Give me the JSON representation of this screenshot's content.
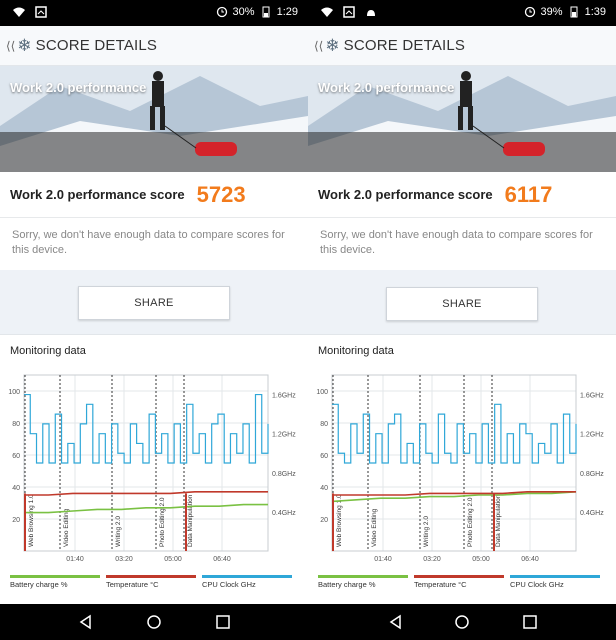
{
  "panels": [
    {
      "status": {
        "battery": "30%",
        "time": "1:29"
      },
      "app_title": "SCORE DETAILS",
      "hero_label": "Work 2.0 performance",
      "score_label": "Work 2.0 performance score",
      "score_value": "5723",
      "sorry_text": "Sorry, we don't have enough data to compare scores for this device.",
      "share_label": "SHARE",
      "monitoring_title": "Monitoring data",
      "chart_data": {
        "type": "line",
        "title": "Monitoring data",
        "y_left_ticks": [
          "100",
          "80",
          "60",
          "40",
          "20"
        ],
        "y_right_ticks": [
          "1.6GHz",
          "1.2GHz",
          "0.8GHz",
          "0.4GHz"
        ],
        "x_ticks": [
          "01:40",
          "03:20",
          "05:00",
          "06:40"
        ],
        "markers": [
          "Web Browsing 1.0",
          "Video Editing",
          "Writing 2.0",
          "Photo Editing 2.0",
          "Data Manipulation"
        ],
        "legend": [
          {
            "name": "Battery charge %",
            "color": "#7ac143"
          },
          {
            "name": "Temperature °C",
            "color": "#c0392b"
          },
          {
            "name": "CPU Clock GHz",
            "color": "#2fa7d8"
          }
        ],
        "series": [
          {
            "name": "Battery charge %",
            "values": [
              24,
              24,
              25,
              26,
              26,
              27,
              27,
              28,
              28,
              29,
              29
            ]
          },
          {
            "name": "Temperature °C",
            "values": [
              35,
              35,
              36,
              36,
              36,
              36,
              36,
              37,
              37,
              37,
              37
            ]
          },
          {
            "name": "CPU Clock GHz",
            "values": [
              1.6,
              1.2,
              0.9,
              1.3,
              0.9,
              1.4,
              0.9,
              1.1,
              0.9,
              1.3,
              1.5,
              0.9,
              1.2,
              0.9,
              1.3,
              1.0,
              0.9,
              1.3,
              1.1,
              0.9,
              1.4,
              1.0,
              1.2,
              0.9,
              1.3,
              0.9,
              1.5,
              1.0,
              1.2,
              0.9,
              1.3,
              1.4,
              0.9,
              1.2,
              1.0,
              1.3,
              0.9,
              1.6,
              1.0,
              1.3
            ]
          }
        ]
      }
    },
    {
      "status": {
        "battery": "39%",
        "time": "1:39"
      },
      "app_title": "SCORE DETAILS",
      "hero_label": "Work 2.0 performance",
      "score_label": "Work 2.0 performance score",
      "score_value": "6117",
      "sorry_text": "Sorry, we don't have enough data to compare scores for this device.",
      "share_label": "SHARE",
      "monitoring_title": "Monitoring data",
      "chart_data": {
        "type": "line",
        "title": "Monitoring data",
        "y_left_ticks": [
          "100",
          "80",
          "60",
          "40",
          "20"
        ],
        "y_right_ticks": [
          "1.6GHz",
          "1.2GHz",
          "0.8GHz",
          "0.4GHz"
        ],
        "x_ticks": [
          "01:40",
          "03:20",
          "05:00",
          "06:40"
        ],
        "markers": [
          "Web Browsing 1.0",
          "Video Editing",
          "Writing 2.0",
          "Photo Editing 2.0",
          "Data Manipulation"
        ],
        "legend": [
          {
            "name": "Battery charge %",
            "color": "#7ac143"
          },
          {
            "name": "Temperature °C",
            "color": "#c0392b"
          },
          {
            "name": "CPU Clock GHz",
            "color": "#2fa7d8"
          }
        ],
        "series": [
          {
            "name": "Battery charge %",
            "values": [
              31,
              32,
              33,
              33,
              34,
              34,
              35,
              35,
              36,
              36,
              37
            ]
          },
          {
            "name": "Temperature °C",
            "values": [
              35,
              35,
              35,
              35,
              36,
              36,
              36,
              36,
              37,
              37,
              37
            ]
          },
          {
            "name": "CPU Clock GHz",
            "values": [
              1.5,
              1.0,
              0.9,
              1.3,
              1.0,
              1.4,
              0.9,
              1.2,
              0.9,
              1.3,
              1.4,
              0.9,
              1.1,
              0.9,
              1.3,
              1.0,
              0.9,
              1.4,
              1.0,
              0.9,
              1.3,
              1.0,
              1.2,
              0.9,
              1.3,
              0.9,
              1.5,
              0.9,
              1.2,
              0.9,
              1.3,
              1.2,
              0.9,
              1.1,
              1.0,
              1.3,
              0.9,
              1.4,
              1.0,
              1.3
            ]
          }
        ]
      }
    }
  ]
}
